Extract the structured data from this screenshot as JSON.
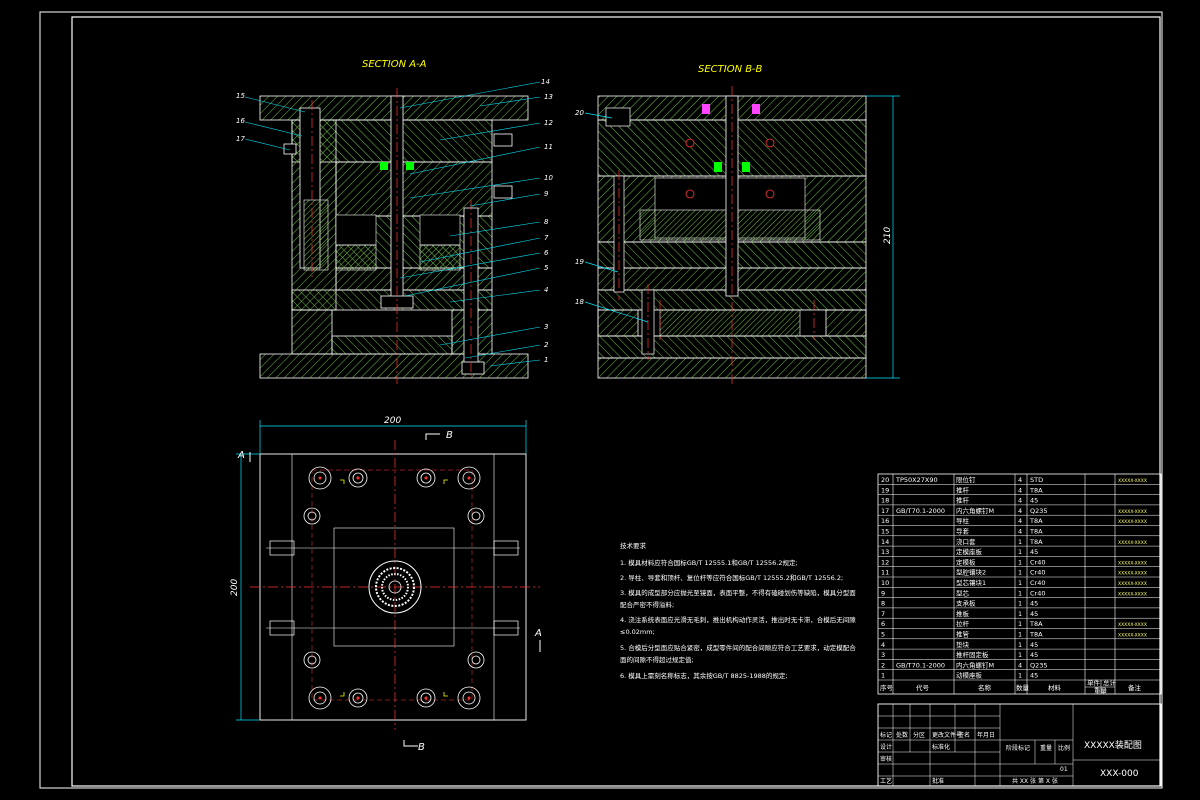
{
  "drawing": {
    "section_aa_title": "SECTION A-A",
    "section_bb_title": "SECTION B-B",
    "dim_height_bb": "210",
    "dim_width_plan": "200",
    "dim_height_plan": "200",
    "cut_label_b_top": "B",
    "cut_label_b_bottom": "B",
    "cut_label_a_left": "A",
    "cut_label_a_right": "A",
    "callouts_aa": [
      "15",
      "16",
      "17",
      "14",
      "13",
      "12",
      "11",
      "10",
      "9",
      "8",
      "7",
      "6",
      "5",
      "4",
      "3",
      "2",
      "1"
    ],
    "callouts_bb": [
      "20",
      "19",
      "18"
    ]
  },
  "notes": {
    "title": "技术要求",
    "lines": [
      "1. 模具材料应符合国标GB/T 12555.1和GB/T 12556.2规定;",
      "2. 导柱、导套和顶杆、复位杆等应符合国标GB/T 12555.2和GB/T 12556.2;",
      "3. 模具的成型部分应抛光至镜面，表面平整，不得有磕碰划伤等缺陷，模具分型面",
      "   配合严密不得溢料;",
      "4. 浇注系统表面应光滑无毛刺，推出机构动作灵活，推出时无卡滞，合模后无间隙",
      "   ≤0.02mm;",
      "5. 合模后分型面应贴合紧密，成型零件间的配合间隙应符合工艺要求，动定模配合",
      "   面的间隙不得超过规定值;",
      "6. 模具上需刻名称标志，其余按GB/T 8825-1988的规定;"
    ]
  },
  "bom": {
    "rows": [
      {
        "no": "20",
        "std": "TP50X27X90",
        "name": "限位钉",
        "qty": "4",
        "mat": "STD",
        "note": "XXXXX-XXXX"
      },
      {
        "no": "19",
        "std": "",
        "name": "推杆",
        "qty": "4",
        "mat": "T8A",
        "note": ""
      },
      {
        "no": "18",
        "std": "",
        "name": "推杆",
        "qty": "4",
        "mat": "45",
        "note": ""
      },
      {
        "no": "17",
        "std": "GB/T70.1-2000",
        "name": "内六角螺钉M",
        "qty": "4",
        "mat": "Q235",
        "note": "XXXXX-XXXX"
      },
      {
        "no": "16",
        "std": "",
        "name": "导柱",
        "qty": "4",
        "mat": "T8A",
        "note": "XXXXX-XXXX"
      },
      {
        "no": "15",
        "std": "",
        "name": "导套",
        "qty": "4",
        "mat": "T8A",
        "note": ""
      },
      {
        "no": "14",
        "std": "",
        "name": "浇口套",
        "qty": "1",
        "mat": "T8A",
        "note": "XXXXX-XXXX"
      },
      {
        "no": "13",
        "std": "",
        "name": "定模座板",
        "qty": "1",
        "mat": "45",
        "note": ""
      },
      {
        "no": "12",
        "std": "",
        "name": "定模板",
        "qty": "1",
        "mat": "Cr40",
        "note": "XXXXX-XXXX"
      },
      {
        "no": "11",
        "std": "",
        "name": "型腔镶块2",
        "qty": "1",
        "mat": "Cr40",
        "note": "XXXXX-XXXX"
      },
      {
        "no": "10",
        "std": "",
        "name": "型芯镶块1",
        "qty": "1",
        "mat": "Cr40",
        "note": "XXXXX-XXXX"
      },
      {
        "no": "9",
        "std": "",
        "name": "型芯",
        "qty": "1",
        "mat": "Cr40",
        "note": "XXXXX-XXXX"
      },
      {
        "no": "8",
        "std": "",
        "name": "支承板",
        "qty": "1",
        "mat": "45",
        "note": ""
      },
      {
        "no": "7",
        "std": "",
        "name": "推板",
        "qty": "1",
        "mat": "45",
        "note": ""
      },
      {
        "no": "6",
        "std": "",
        "name": "拉杆",
        "qty": "1",
        "mat": "T8A",
        "note": "XXXXX-XXXX"
      },
      {
        "no": "5",
        "std": "",
        "name": "推管",
        "qty": "1",
        "mat": "T8A",
        "note": "XXXXX-XXXX"
      },
      {
        "no": "4",
        "std": "",
        "name": "垫块",
        "qty": "1",
        "mat": "45",
        "note": ""
      },
      {
        "no": "3",
        "std": "",
        "name": "推杆固定板",
        "qty": "1",
        "mat": "45",
        "note": ""
      },
      {
        "no": "2",
        "std": "GB/T70.1-2000",
        "name": "内六角螺钉M",
        "qty": "4",
        "mat": "Q235",
        "note": ""
      },
      {
        "no": "1",
        "std": "",
        "name": "动模座板",
        "qty": "1",
        "mat": "45",
        "note": ""
      }
    ],
    "header": {
      "no": "序号",
      "std": "代号",
      "name": "名称",
      "qty": "数量",
      "mat": "材料",
      "weight_single": "单件",
      "weight_total": "总计",
      "weight": "重量",
      "note": "备注"
    }
  },
  "title_block": {
    "drawing_name": "XXXXX装配图",
    "drawing_code": "XXX-000",
    "sheet": "共 XX 张  第 X 张",
    "scale_ratio": "01",
    "labels": [
      "标记",
      "处数",
      "分区",
      "更改文件号",
      "签名",
      "年月日",
      "设计",
      "标准化",
      "阶段标记",
      "重量",
      "比例",
      "审核",
      "工艺",
      "批准"
    ]
  },
  "colors": {
    "background": "#000000",
    "outline": "#ffffff",
    "hatch": "#6fbf40",
    "centerline": "#ff3333",
    "dimension": "#00e5ff",
    "title_text": "#ffff00",
    "highlight_green": "#00ff00",
    "highlight_magenta": "#ff44ff"
  }
}
